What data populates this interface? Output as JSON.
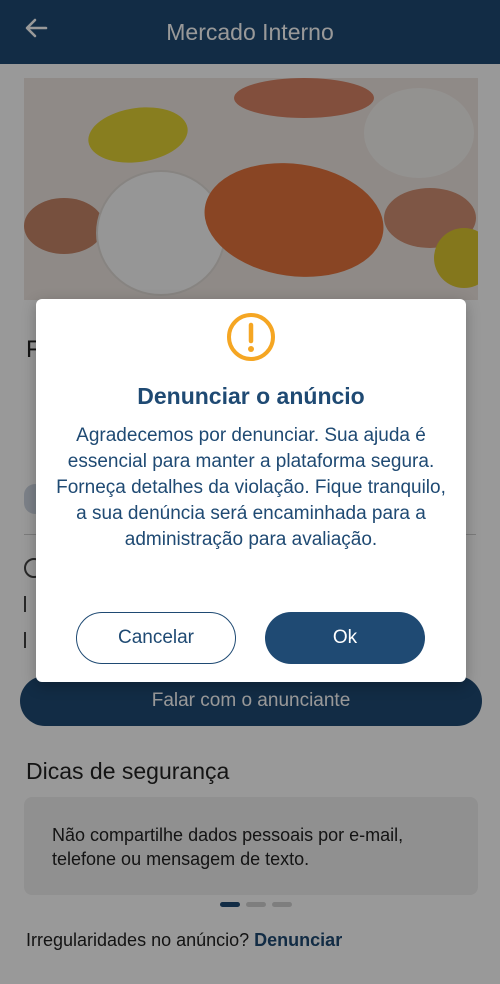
{
  "app": {
    "title": "Mercado Interno"
  },
  "listing": {
    "title_fragment": "F",
    "contact_button": "Falar com o anunciante"
  },
  "safety": {
    "title": "Dicas de segurança",
    "tip": "Não compartilhe dados pessoais por e-mail, telefone ou mensagem de texto.",
    "carousel_pages": 3,
    "carousel_active": 1
  },
  "report": {
    "prompt": "Irregularidades no anúncio?",
    "link": "Denunciar"
  },
  "dialog": {
    "icon": "warning-icon",
    "title": "Denunciar o anúncio",
    "body": "Agradecemos por denunciar. Sua ajuda é essencial para manter a plataforma segura. Forneça detalhes da violação. Fique tranquilo, a sua denúncia será encaminhada para a administração para avaliação.",
    "cancel_label": "Cancelar",
    "ok_label": "Ok"
  },
  "colors": {
    "primary": "#1f4a73",
    "accent": "#f5a623"
  }
}
